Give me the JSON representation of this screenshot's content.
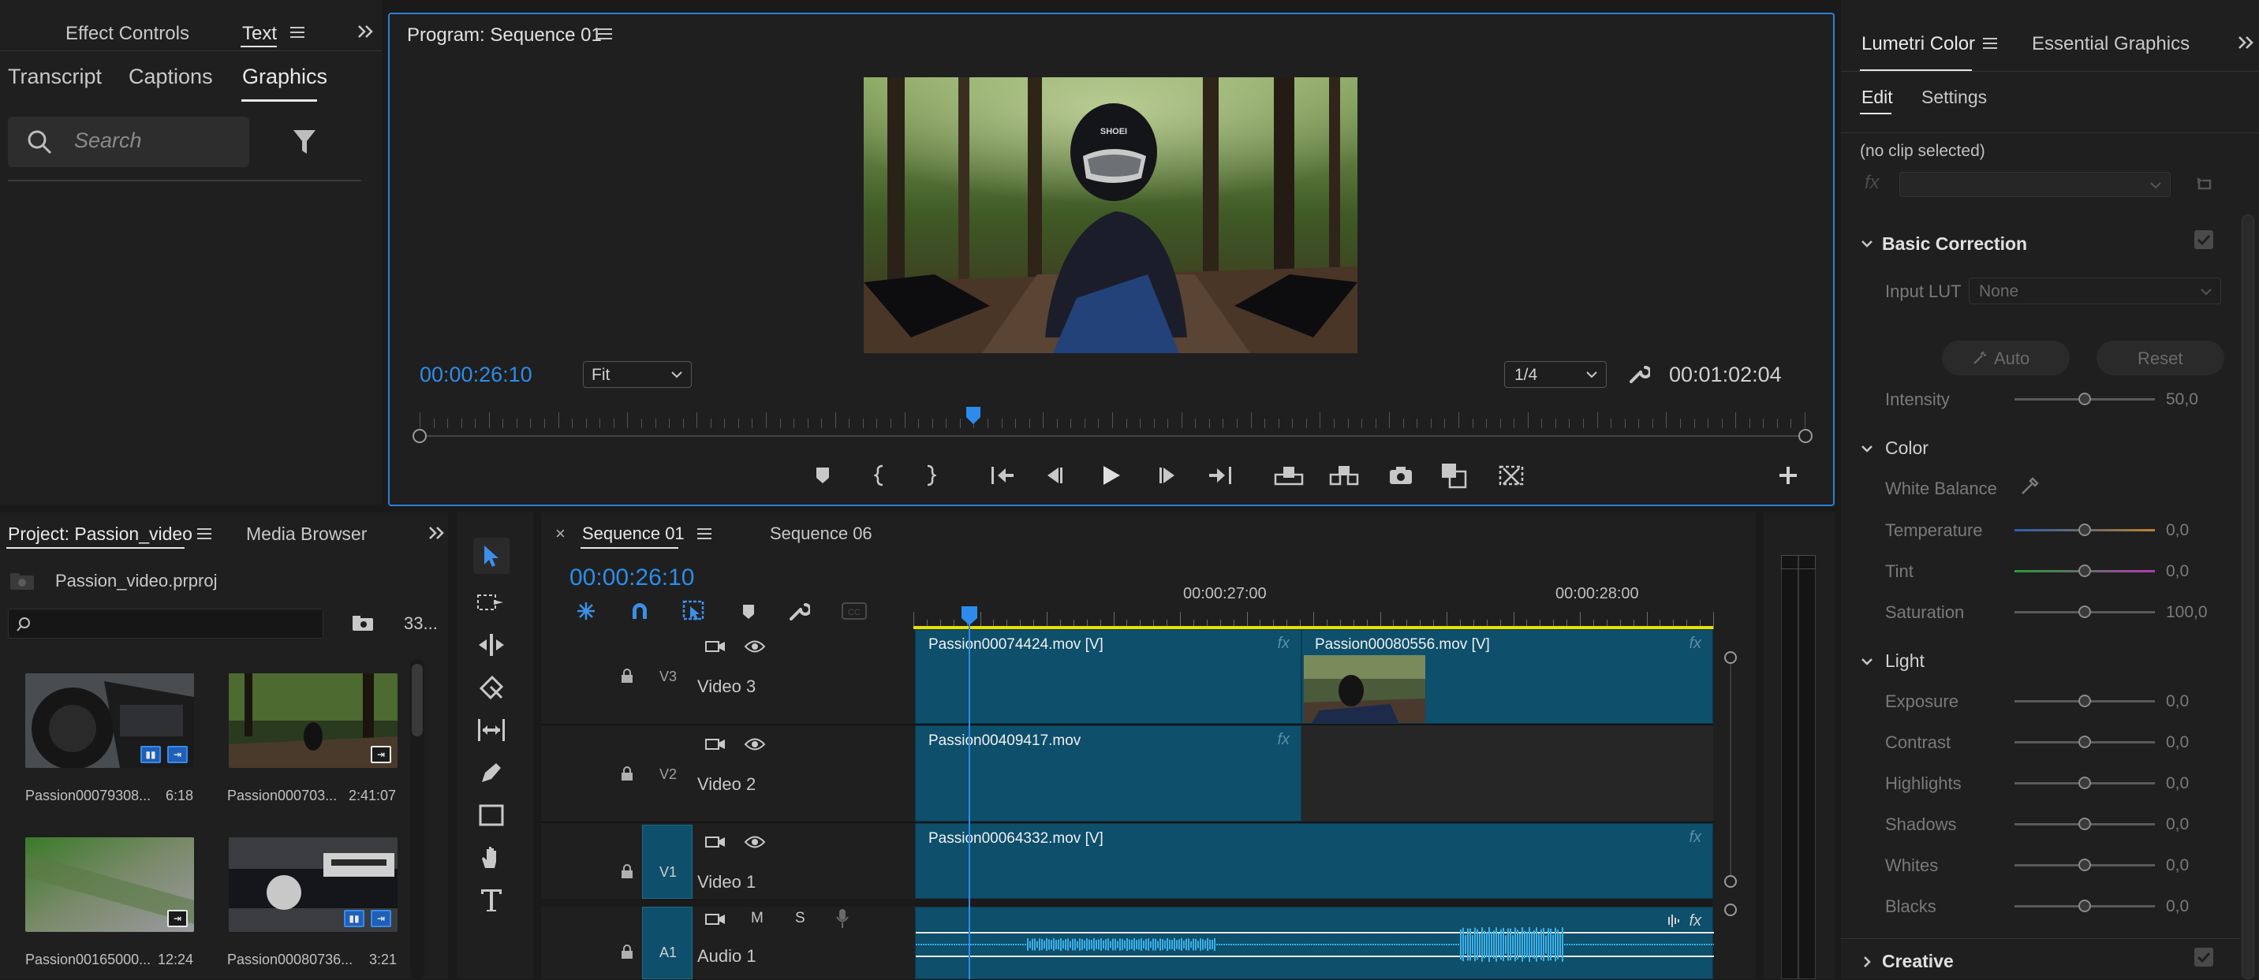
{
  "left_panel": {
    "tabs": [
      {
        "label": "Effect Controls"
      },
      {
        "label": "Text"
      }
    ],
    "subtabs": [
      {
        "label": "Transcript"
      },
      {
        "label": "Captions"
      },
      {
        "label": "Graphics"
      }
    ],
    "search_placeholder": "Search"
  },
  "program_monitor": {
    "title": "Program: Sequence 01",
    "current_timecode": "00:00:26:10",
    "fit_value": "Fit",
    "resolution_value": "1/4",
    "duration_timecode": "00:01:02:04",
    "playhead_position": 0.4,
    "helmet_text": "SHOEI"
  },
  "lumetri": {
    "tabs": [
      {
        "label": "Lumetri Color"
      },
      {
        "label": "Essential Graphics"
      }
    ],
    "subtabs": [
      {
        "label": "Edit"
      },
      {
        "label": "Settings"
      }
    ],
    "no_clip": "(no clip selected)",
    "fx_label": "fx",
    "basic_correction": "Basic Correction",
    "input_lut_label": "Input LUT",
    "input_lut_value": "None",
    "auto_label": "Auto",
    "reset_label": "Reset",
    "intensity_label": "Intensity",
    "intensity_value": "50,0",
    "color_section": "Color",
    "white_balance_label": "White Balance",
    "color_rows": [
      {
        "label": "Temperature",
        "value": "0,0",
        "level": 0.5
      },
      {
        "label": "Tint",
        "value": "0,0",
        "level": 0.5
      },
      {
        "label": "Saturation",
        "value": "100,0",
        "level": 0.5
      }
    ],
    "light_section": "Light",
    "light_rows": [
      {
        "label": "Exposure",
        "value": "0,0",
        "level": 0.5
      },
      {
        "label": "Contrast",
        "value": "0,0",
        "level": 0.5
      },
      {
        "label": "Highlights",
        "value": "0,0",
        "level": 0.5
      },
      {
        "label": "Shadows",
        "value": "0,0",
        "level": 0.5
      },
      {
        "label": "Whites",
        "value": "0,0",
        "level": 0.5
      },
      {
        "label": "Blacks",
        "value": "0,0",
        "level": 0.5
      }
    ],
    "creative_section": "Creative"
  },
  "project": {
    "tabs": [
      {
        "label": "Project: Passion_video"
      },
      {
        "label": "Media Browser"
      }
    ],
    "file_name": "Passion_video.prproj",
    "item_count": "33...",
    "items": [
      {
        "name": "Passion00079308...",
        "duration": "6:18"
      },
      {
        "name": "Passion000703...",
        "duration": "2:41:07"
      },
      {
        "name": "Passion00165000...",
        "duration": "12:24"
      },
      {
        "name": "Passion00080736...",
        "duration": "3:21"
      }
    ]
  },
  "timeline": {
    "tabs": [
      {
        "label": "Sequence 01"
      },
      {
        "label": "Sequence 06"
      }
    ],
    "close_glyph": "×",
    "timecode": "00:00:26:10",
    "ruler_labels": [
      "00:00:27:00",
      "00:00:28:00"
    ],
    "tracks": [
      {
        "id": "V3",
        "name": "Video 3"
      },
      {
        "id": "V2",
        "name": "Video 2"
      },
      {
        "id": "V1",
        "name": "Video 1"
      },
      {
        "id": "A1",
        "name": "Audio 1"
      }
    ],
    "audio_buttons": {
      "mute": "M",
      "solo": "S"
    },
    "clips": [
      {
        "name": "Passion00074424.mov [V]"
      },
      {
        "name": "Passion00080556.mov [V]"
      },
      {
        "name": "Passion00409417.mov"
      },
      {
        "name": "Passion00064332.mov [V]"
      }
    ],
    "fx_label": "fx"
  },
  "colors": {
    "accent": "#2d8ceb",
    "clip": "#0e4f6b",
    "panel": "#232323",
    "background": "#1a1a1a"
  }
}
